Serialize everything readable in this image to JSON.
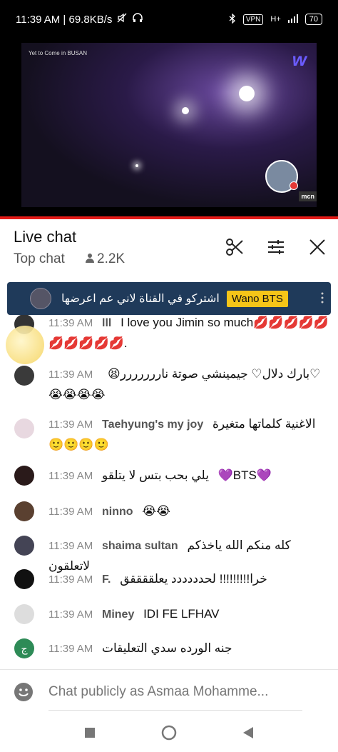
{
  "status_bar": {
    "time_speed": "11:39 AM | 69.8KB/s",
    "vpn": "VPN",
    "network": "H+",
    "battery": "70"
  },
  "video": {
    "channel_logo": "w",
    "show_logo": "Yet to Come in BUSAN",
    "corner_logo": "mcn"
  },
  "chat": {
    "title": "Live chat",
    "mode": "Top chat",
    "viewers": "2.2K",
    "pinned": {
      "author": "Wano BTS",
      "text": "اشتركو في القناة لاني عم اعرضها"
    },
    "messages": [
      {
        "time": "11:39 AM",
        "author": "lll",
        "text": "I love you Jimin so much💋💋💋💋💋💋💋💋💋💋."
      },
      {
        "time": "11:39 AM",
        "author": "",
        "text": "😫بارك دلال♡ جيمينشي صوتة ناررررررر♡😭😭😭😭"
      },
      {
        "time": "11:39 AM",
        "author": "Taehyung's my joy",
        "text": "الاغنية كلماتها متغيرة 🙂🙂🙂🙂"
      },
      {
        "time": "11:39 AM",
        "author": "",
        "text": "يلي بحب بتس لا يتلقو 💜BTS💜"
      },
      {
        "time": "11:39 AM",
        "author": "ninno",
        "text": "😭😭"
      },
      {
        "time": "11:39 AM",
        "author": "shaima sultan",
        "text": "كله منكم الله ياخذكم لاتعلقون"
      },
      {
        "time": "11:39 AM",
        "author": "F.",
        "text": "خرا!!!!!!!!! لحدددددد يعلققققق"
      },
      {
        "time": "11:39 AM",
        "author": "Miney",
        "text": "IDI FE LFHAV"
      },
      {
        "time": "11:39 AM",
        "author": "",
        "text": "جنه الورده سدي التعليقات"
      }
    ],
    "input_placeholder": "Chat publicly as Asmaa Mohamme..."
  },
  "colors": {
    "accent_red": "#e41b17",
    "pinned_bg": "#1f3a5a",
    "author_badge": "#f5c518"
  }
}
